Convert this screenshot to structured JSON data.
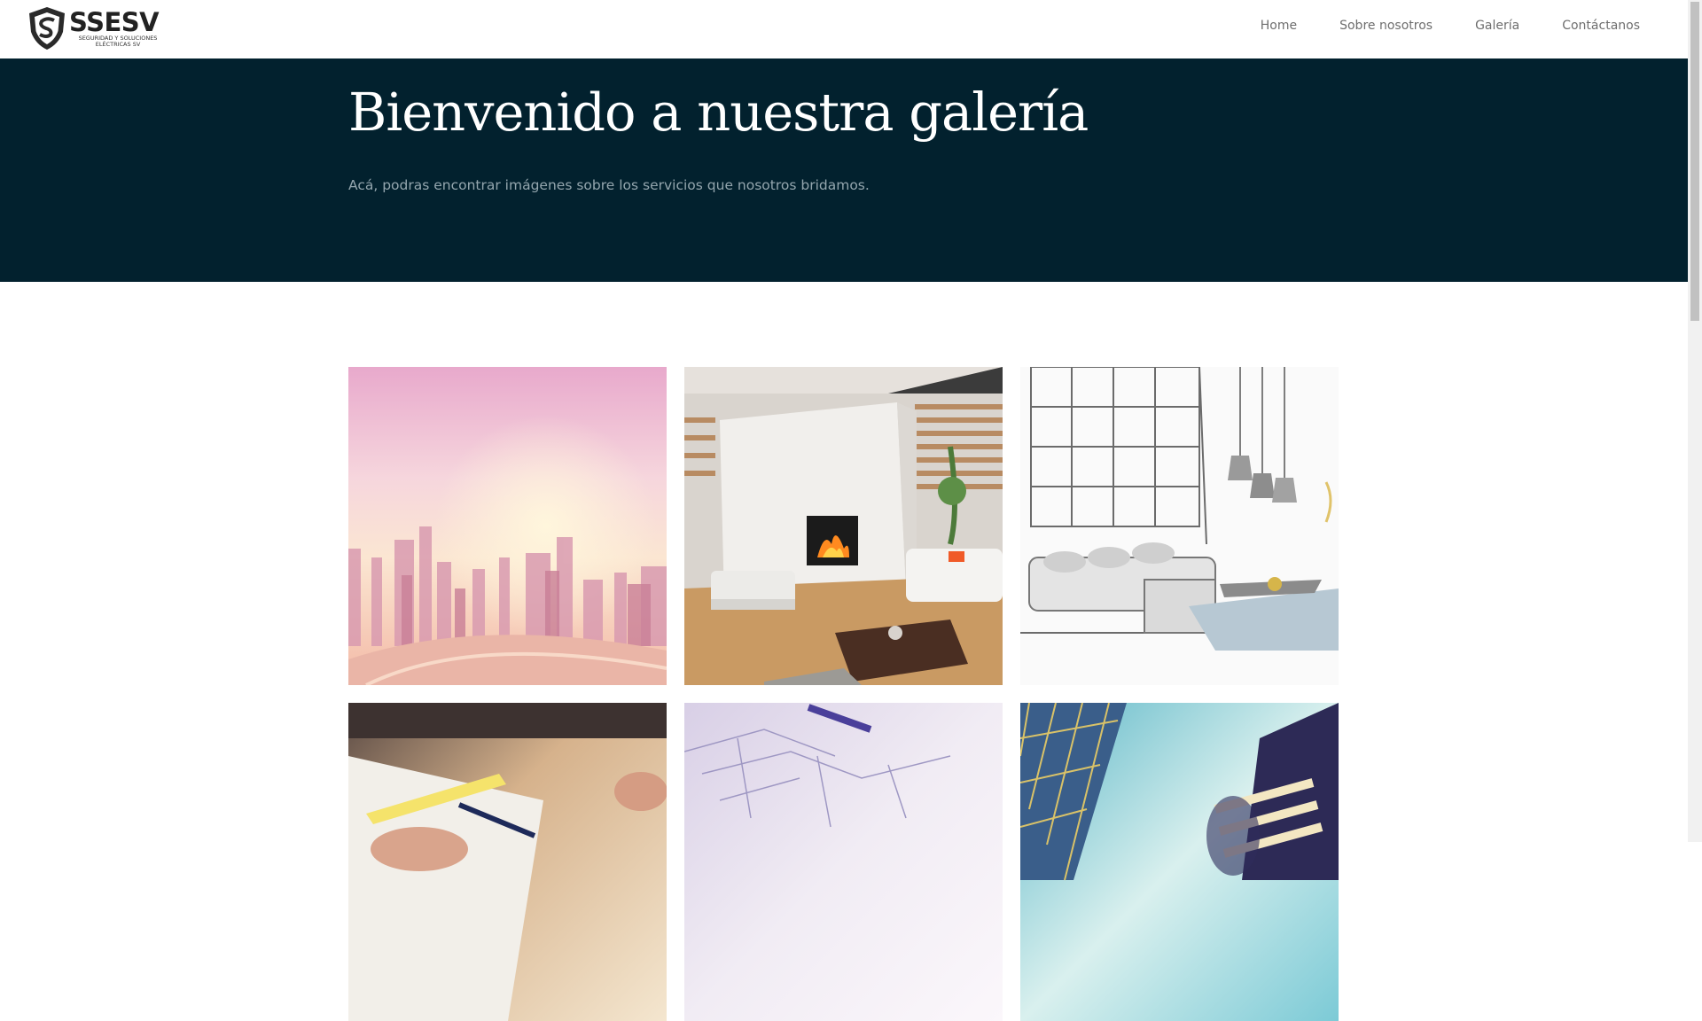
{
  "header": {
    "logo": {
      "brand": "SSESV",
      "subtitle_line1": "SEGURIDAD Y SOLUCIONES",
      "subtitle_line2": "ELÉCTRICAS SV"
    },
    "nav": [
      {
        "label": "Home"
      },
      {
        "label": "Sobre nosotros"
      },
      {
        "label": "Galería"
      },
      {
        "label": "Contáctanos"
      }
    ]
  },
  "hero": {
    "title": "Bienvenido a nuestra galería",
    "subtitle": "Acá, podras encontrar imágenes sobre los servicios que nosotros bridamos."
  },
  "gallery": {
    "items": [
      {
        "subject": "pink city skyline"
      },
      {
        "subject": "living room with fireplace"
      },
      {
        "subject": "sketched loft interior with pendant lamps"
      },
      {
        "subject": "hands drawing on blueprint"
      },
      {
        "subject": "architectural floor plan"
      },
      {
        "subject": "skyscrapers looking up"
      }
    ]
  },
  "colors": {
    "hero_bg": "#02212e",
    "hero_title": "#ffffff",
    "hero_subtitle": "#94a6ae",
    "nav_text": "#6e6e6e"
  }
}
